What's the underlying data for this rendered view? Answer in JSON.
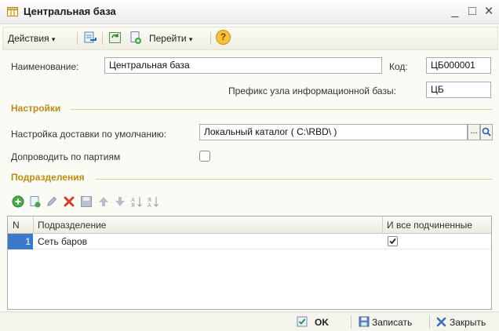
{
  "window": {
    "title": "Центральная база",
    "minimize": "_",
    "maximize": "□",
    "close": "×"
  },
  "toolbar": {
    "actions_label": "Действия",
    "goto_label": "Перейти",
    "dropdown_arrow": "▾",
    "help_label": "?"
  },
  "form": {
    "name_label": "Наименование:",
    "name_value": "Центральная база",
    "code_label": "Код:",
    "code_value": "ЦБ000001",
    "prefix_label": "Префикс узла информационной базы:",
    "prefix_value": "ЦБ"
  },
  "settings": {
    "heading": "Настройки",
    "delivery_label": "Настройка доставки по умолчанию:",
    "delivery_value": "Локальный каталог ( C:\\RBD\\ )",
    "select_button": "...",
    "batch_label": "Допроводить по партиям",
    "batch_checked": false
  },
  "divisions": {
    "heading": "Подразделения",
    "columns": {
      "num": "N",
      "division": "Подразделение",
      "all_sub": "И все подчиненные"
    },
    "rows": [
      {
        "num": "1",
        "division": "Сеть баров",
        "all_sub": true
      }
    ]
  },
  "footer": {
    "ok_label": "OK",
    "save_label": "Записать",
    "close_label": "Закрыть"
  },
  "colors": {
    "section": "#b98c14",
    "row_highlight": "#3b79c9",
    "accent_red": "#d43f2a",
    "accent_green": "#46a84a"
  }
}
